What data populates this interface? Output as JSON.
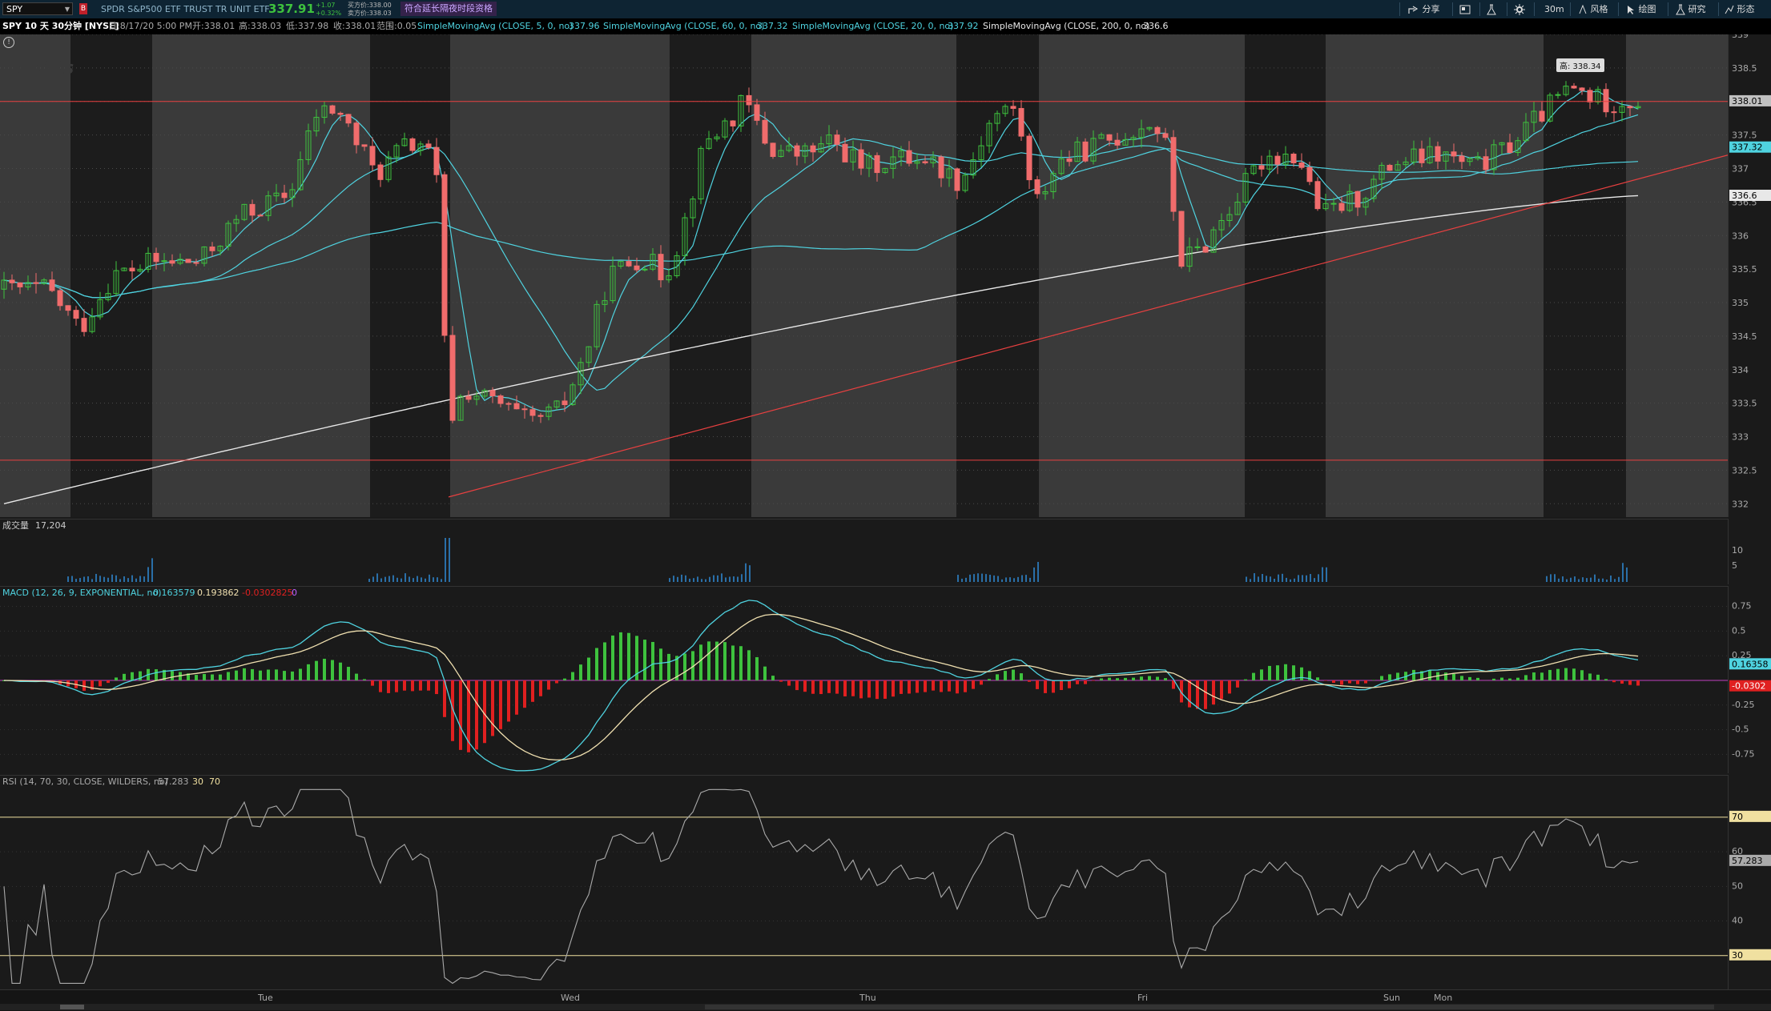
{
  "topbar": {
    "symbol": "SPY",
    "badge": "B",
    "description": "SPDR S&P500 ETF TRUST TR UNIT ETF",
    "last_price": "337.91",
    "change_abs": "+1.07",
    "change_pct": "+0.32%",
    "bid_label": "买方价:338.00",
    "ask_label": "卖方价:338.03",
    "promo": "符合延长隔夜时段资格",
    "tools": {
      "share": "分享",
      "interval": "30m",
      "style": "风格",
      "drawing": "绘图",
      "studies": "研究",
      "patterns": "形态"
    }
  },
  "infobar": {
    "title": "SPY 10 天 30分钟 [NYSE]",
    "date": "日:8/17/20 5:00 PM",
    "open": "开:338.01",
    "high": "高:338.03",
    "low": "低:337.98",
    "close": "收:338.01",
    "range": "范围:0.05",
    "sma5_label": "SimpleMovingAvg (CLOSE, 5, 0, no)",
    "sma5_val": "337.96",
    "sma60_label": "SimpleMovingAvg (CLOSE, 60, 0, no)",
    "sma60_val": "337.32",
    "sma20_label": "SimpleMovingAvg (CLOSE, 20, 0, no)",
    "sma20_val": "337.92",
    "sma200_label": "SimpleMovingAvg (CLOSE, 200, 0, no)",
    "sma200_val": "336.6"
  },
  "price_panel": {
    "watermark": "SPDRs",
    "high_tag": "高: 338.34",
    "axis_ticks": [
      "339",
      "338.5",
      "338",
      "337.5",
      "337",
      "336.5",
      "336",
      "335.5",
      "335",
      "334.5",
      "334",
      "333.5",
      "333",
      "332.5",
      "332"
    ],
    "tags": {
      "last": "338.01",
      "sma60": "337.32",
      "sma200": "336.6"
    }
  },
  "volume_panel": {
    "label": "成交量",
    "value": "17,204",
    "axis_ticks": [
      "10",
      "5"
    ]
  },
  "macd_panel": {
    "label": "MACD (12, 26, 9, EXPONENTIAL, no)",
    "value": "0.163579",
    "avg": "0.193862",
    "diff": "-0.0302825",
    "zero": "0",
    "axis_ticks": [
      "0.75",
      "0.5",
      "0.25",
      "0",
      "-0.25",
      "-0.5",
      "-0.75"
    ],
    "tags": {
      "value": "0.16358",
      "diff": "-0.0302"
    }
  },
  "rsi_panel": {
    "label": "RSI (14, 70, 30, CLOSE, WILDERS, no)",
    "value": "57.283",
    "os": "30",
    "ob": "70",
    "axis_ticks": [
      "70",
      "60",
      "50",
      "40",
      "30"
    ],
    "tags": {
      "value": "57.283"
    }
  },
  "xaxis": {
    "labels": [
      "Tue",
      "Wed",
      "Thu",
      "Fri",
      "Sun",
      "Mon"
    ]
  },
  "colors": {
    "up": "#3ec23e",
    "down": "#f06c6c",
    "sma_fast": "#4fd3e0",
    "sma200": "#e8e8e8",
    "macd": "#4fd3e0",
    "macd_avg": "#f0e0b0",
    "hist_pos": "#3ec23e",
    "hist_neg": "#e02020",
    "rsi": "#aaaaaa",
    "level": "#f0e0a0",
    "support": "#e84040"
  }
}
